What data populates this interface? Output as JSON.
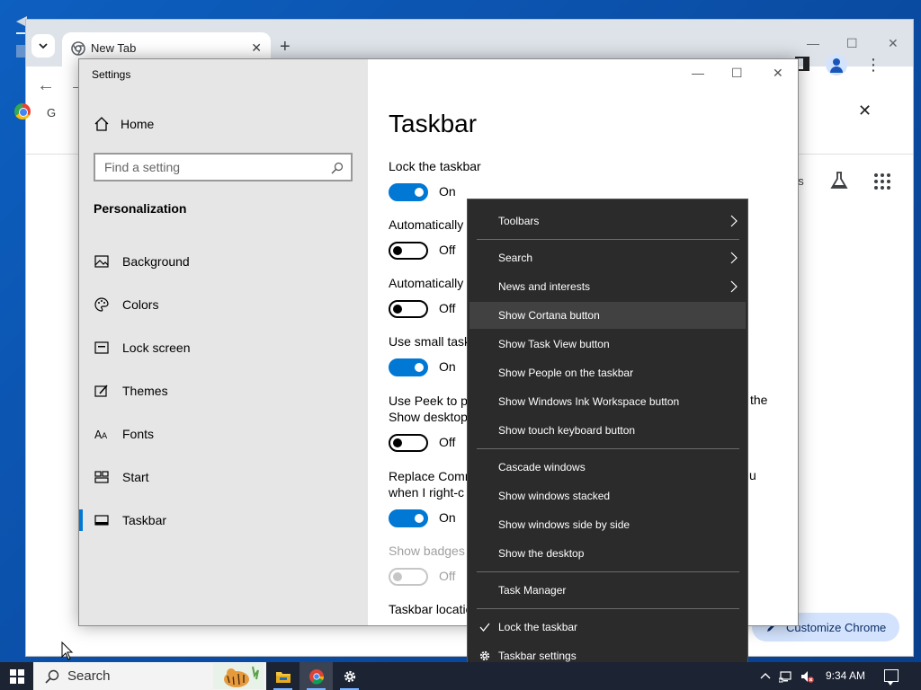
{
  "chrome": {
    "tab_title": "New Tab",
    "tab_close_glyph": "✕",
    "new_tab_glyph": "+",
    "minimize_glyph": "—",
    "maximize_glyph": "☐",
    "close_glyph": "✕",
    "back_glyph": "←",
    "forward_glyph": "→",
    "more_glyph": "⋮",
    "infobar_text": "G",
    "infobar_close_glyph": "✕",
    "ntp_partial_text": "es",
    "customize_label": "Customize Chrome"
  },
  "settings": {
    "window_title": "Settings",
    "home_label": "Home",
    "search_placeholder": "Find a setting",
    "section_heading": "Personalization",
    "nav_items": [
      {
        "label": "Background",
        "icon": "image-icon"
      },
      {
        "label": "Colors",
        "icon": "palette-icon"
      },
      {
        "label": "Lock screen",
        "icon": "lock-screen-icon"
      },
      {
        "label": "Themes",
        "icon": "themes-icon"
      },
      {
        "label": "Fonts",
        "icon": "fonts-icon"
      },
      {
        "label": "Start",
        "icon": "start-icon"
      },
      {
        "label": "Taskbar",
        "icon": "taskbar-icon",
        "active": true
      }
    ],
    "page_title": "Taskbar",
    "options": [
      {
        "label": "Lock the taskbar",
        "state": "On"
      },
      {
        "label": "Automatically",
        "state": "Off"
      },
      {
        "label": "Automatically",
        "state": "Off"
      },
      {
        "label": "Use small task",
        "state": "On"
      },
      {
        "label_line1": "Use Peek to pr",
        "label_line2": "Show desktop",
        "overflow": "the",
        "state": "Off"
      },
      {
        "label_line1": "Replace Comm",
        "label_line2": "when I right-c",
        "overflow": "u",
        "state": "On"
      },
      {
        "label": "Show badges",
        "state": "Off",
        "disabled": true
      },
      {
        "label": "Taskbar locatio"
      }
    ],
    "minimize_glyph": "—",
    "maximize_glyph": "☐",
    "close_glyph": "✕"
  },
  "context_menu": {
    "groups": [
      [
        {
          "label": "Toolbars",
          "submenu": true
        }
      ],
      [
        {
          "label": "Search",
          "submenu": true
        },
        {
          "label": "News and interests",
          "submenu": true
        },
        {
          "label": "Show Cortana button",
          "highlighted": true
        },
        {
          "label": "Show Task View button"
        },
        {
          "label": "Show People on the taskbar"
        },
        {
          "label": "Show Windows Ink Workspace button"
        },
        {
          "label": "Show touch keyboard button"
        }
      ],
      [
        {
          "label": "Cascade windows"
        },
        {
          "label": "Show windows stacked"
        },
        {
          "label": "Show windows side by side"
        },
        {
          "label": "Show the desktop"
        }
      ],
      [
        {
          "label": "Task Manager"
        }
      ],
      [
        {
          "label": "Lock the taskbar",
          "checked": true
        },
        {
          "label": "Taskbar settings",
          "icon": "gear-icon"
        }
      ]
    ]
  },
  "taskbar": {
    "search_label": "Search",
    "clock": "9:34 AM",
    "accent": "#0078d4"
  }
}
